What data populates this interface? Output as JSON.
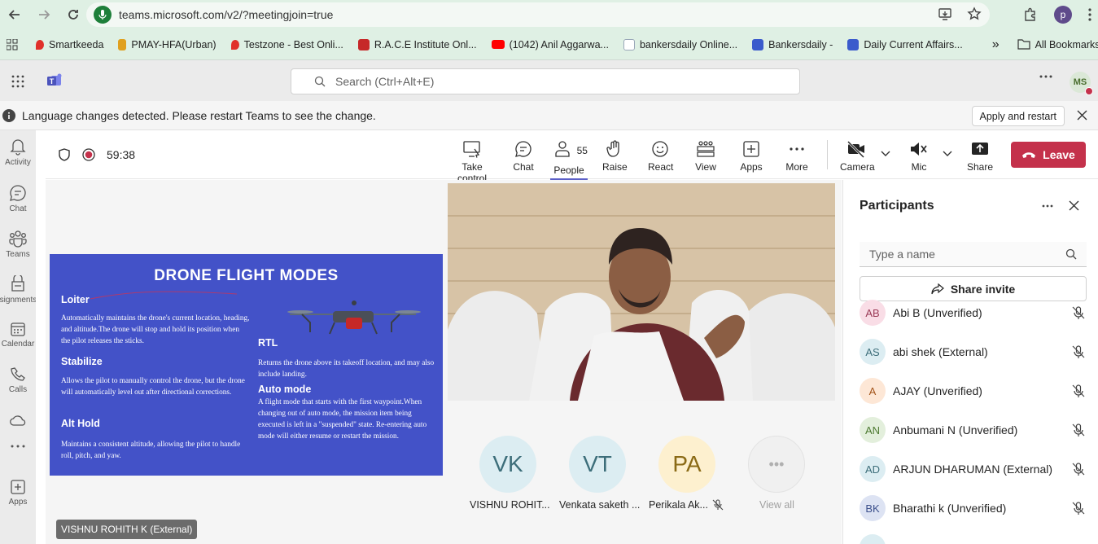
{
  "browser": {
    "url": "teams.microsoft.com/v2/?meetingjoin=true",
    "profile_initial": "p",
    "bookmarks": [
      {
        "label": "Smartkeeda",
        "color": "#e0312a"
      },
      {
        "label": "PMAY-HFA(Urban)",
        "color": "#e0a01e"
      },
      {
        "label": "Testzone - Best Onli...",
        "color": "#e0312a"
      },
      {
        "label": "R.A.C.E Institute Onl...",
        "color": "#c62828"
      },
      {
        "label": "(1042) Anil Aggarwa...",
        "color": "#ff0000"
      },
      {
        "label": "bankersdaily Online...",
        "color": "#9aa7b8"
      },
      {
        "label": "Bankersdaily -",
        "color": "#3b5bcc"
      },
      {
        "label": "Daily Current Affairs...",
        "color": "#3b5bcc"
      }
    ],
    "all_bookmarks": "All Bookmarks"
  },
  "teams": {
    "search_placeholder": "Search (Ctrl+Alt+E)",
    "user_initials": "MS"
  },
  "notice": {
    "text": "Language changes detected. Please restart Teams to see the change.",
    "apply_label": "Apply and restart"
  },
  "rail": [
    {
      "label": "Activity",
      "icon": "bell-icon"
    },
    {
      "label": "Chat",
      "icon": "chat-icon"
    },
    {
      "label": "Teams",
      "icon": "teams-icon"
    },
    {
      "label": "Assignments",
      "icon": "assignments-icon"
    },
    {
      "label": "Calendar",
      "icon": "calendar-icon"
    },
    {
      "label": "Calls",
      "icon": "phone-icon"
    },
    {
      "label": "Apps",
      "icon": "apps-icon"
    }
  ],
  "meeting": {
    "timer": "59:38",
    "people_count": "55",
    "tools": {
      "take_control": "Take control",
      "chat": "Chat",
      "people": "People",
      "raise": "Raise",
      "react": "React",
      "view": "View",
      "apps": "Apps",
      "more": "More",
      "camera": "Camera",
      "mic": "Mic",
      "share": "Share"
    },
    "leave_label": "Leave",
    "presenter_tag": "VISHNU ROHITH K (External)"
  },
  "slide": {
    "title": "DRONE FLIGHT MODES",
    "sections": [
      {
        "heading": "Loiter",
        "body": "Automatically maintains the drone's current location, heading, and altitude.The drone will stop and hold its position when the pilot releases the sticks."
      },
      {
        "heading": "Stabilize",
        "body": "Allows the pilot to manually control the drone, but the drone will automatically level out after directional corrections."
      },
      {
        "heading": "Alt Hold",
        "body": "Maintains a consistent altitude, allowing the pilot to handle roll, pitch, and yaw."
      },
      {
        "heading": "RTL",
        "body": "Returns the drone above its takeoff location, and may also include landing."
      },
      {
        "heading": "Auto mode",
        "body": "A flight mode that starts with the first waypoint.When changing out of auto mode, the mission item being executed is left in a \"suspended\" state. Re-entering auto mode will either resume or restart the mission."
      }
    ]
  },
  "tiles": [
    {
      "initials": "VK",
      "name": "VISHNU ROHIT...",
      "bg": "#dcedf2",
      "fg": "#3d6e7a"
    },
    {
      "initials": "VT",
      "name": "Venkata saketh ...",
      "bg": "#dcedf2",
      "fg": "#3d6e7a"
    },
    {
      "initials": "PA",
      "name": "Perikala Ak...",
      "bg": "#fdf0cf",
      "fg": "#8a6a16"
    },
    {
      "initials": "•••",
      "name": "View all",
      "bg": "#f0f0f0",
      "fg": "#b0b0b0"
    }
  ],
  "participants": {
    "title": "Participants",
    "search_placeholder": "Type a name",
    "share_invite": "Share invite",
    "list": [
      {
        "initials": "AB",
        "name": "Abi B (Unverified)",
        "bg": "#f9dde6",
        "fg": "#9b3b57"
      },
      {
        "initials": "AS",
        "name": "abi shek (External)",
        "bg": "#dcedf2",
        "fg": "#3d6e7a"
      },
      {
        "initials": "A",
        "name": "AJAY (Unverified)",
        "bg": "#fde7d6",
        "fg": "#a3541b"
      },
      {
        "initials": "AN",
        "name": "Anbumani N (Unverified)",
        "bg": "#e3efdc",
        "fg": "#4d7a31"
      },
      {
        "initials": "AD",
        "name": "ARJUN DHARUMAN (External)",
        "bg": "#dcedf2",
        "fg": "#3d6e7a"
      },
      {
        "initials": "BK",
        "name": "Bharathi k (Unverified)",
        "bg": "#dde3f3",
        "fg": "#3b4f8b"
      }
    ]
  }
}
